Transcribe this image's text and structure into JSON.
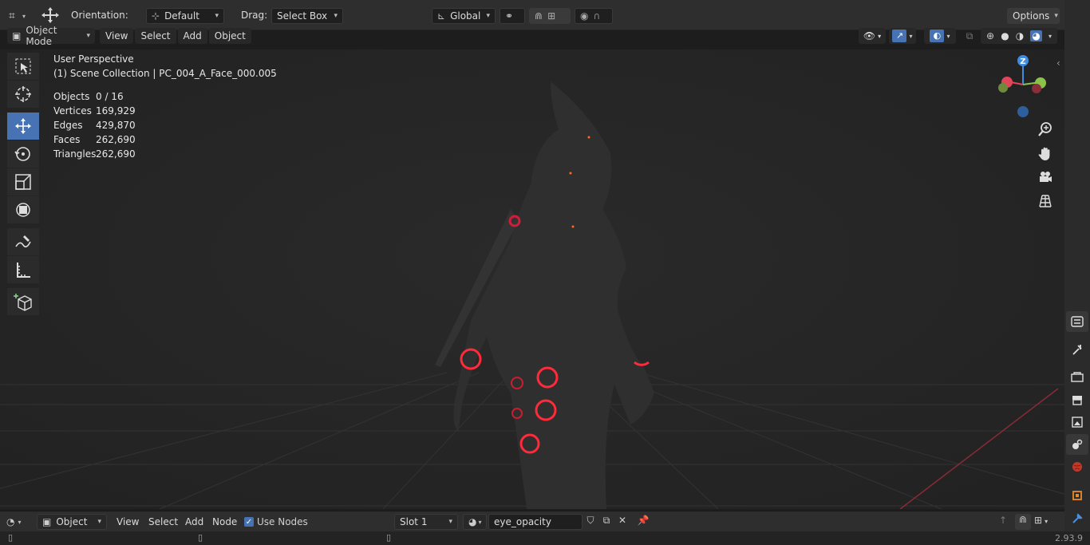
{
  "top_toolbar": {
    "orientation_label": "Orientation:",
    "orientation_value": "Default",
    "drag_label": "Drag:",
    "drag_value": "Select Box",
    "transform_orientation": "Global",
    "options_label": "Options"
  },
  "header": {
    "mode": "Object Mode",
    "menus": [
      "View",
      "Select",
      "Add",
      "Object"
    ]
  },
  "overlay": {
    "view_name": "User Perspective",
    "collection_line": "(1) Scene Collection | PC_004_A_Face_000.005",
    "stats": [
      {
        "key": "Objects",
        "value": "0 / 16"
      },
      {
        "key": "Vertices",
        "value": "169,929"
      },
      {
        "key": "Edges",
        "value": "429,870"
      },
      {
        "key": "Faces",
        "value": "262,690"
      },
      {
        "key": "Triangles",
        "value": "262,690"
      }
    ]
  },
  "gizmo": {
    "z_label": "Z"
  },
  "tools": [
    "select-box-icon",
    "cursor-icon",
    "move-icon",
    "rotate-icon",
    "scale-icon",
    "transform-icon",
    "annotate-icon",
    "measure-icon",
    "add-cube-icon"
  ],
  "bottom_header": {
    "type": "Object",
    "menus": [
      "View",
      "Select",
      "Add",
      "Node"
    ],
    "use_nodes_label": "Use Nodes",
    "use_nodes_checked": true,
    "slot": "Slot 1",
    "material_name": "eye_opacity"
  },
  "status": {
    "version": "2.93.9"
  },
  "colors": {
    "accent": "#4772b3",
    "axis_x": "#e0455a",
    "axis_y": "#8bc34a",
    "axis_z": "#3f8ce0",
    "glow": "#ff2a3a"
  }
}
